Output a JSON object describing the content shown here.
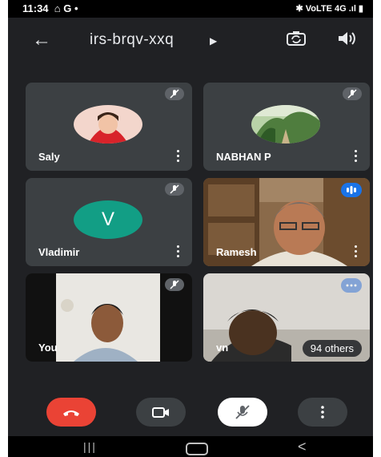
{
  "status_bar": {
    "time": "11:34",
    "left_icons": "⌂ G •",
    "right_icons": "✱ VoLTE 4G .ıl ▮"
  },
  "app_bar": {
    "meeting_code": "irs-brqv-xxq",
    "back_icon": "arrow-left-icon",
    "switch_camera_icon": "camera-switch-icon",
    "speaker_icon": "speaker-icon"
  },
  "participants": [
    {
      "name": "Saly",
      "muted": true,
      "tile": "avatar-photo"
    },
    {
      "name": "NABHAN P",
      "muted": true,
      "tile": "avatar-photo"
    },
    {
      "name": "Vladimir",
      "muted": true,
      "tile": "initial",
      "initial": "V",
      "avatar_color": "#129e85"
    },
    {
      "name": "Ramesh",
      "muted": false,
      "speaking": true,
      "tile": "video"
    },
    {
      "name": "You",
      "muted": true,
      "tile": "video"
    },
    {
      "name": "vn",
      "muted": false,
      "tile": "video",
      "others_label": "94 others"
    }
  ],
  "controls": {
    "end_call_color": "#ea4335",
    "items": [
      "end-call",
      "camera",
      "microphone-off",
      "more-options"
    ]
  },
  "colors": {
    "background": "#202124",
    "tile": "#3c4043",
    "accent": "#1a73e8"
  }
}
